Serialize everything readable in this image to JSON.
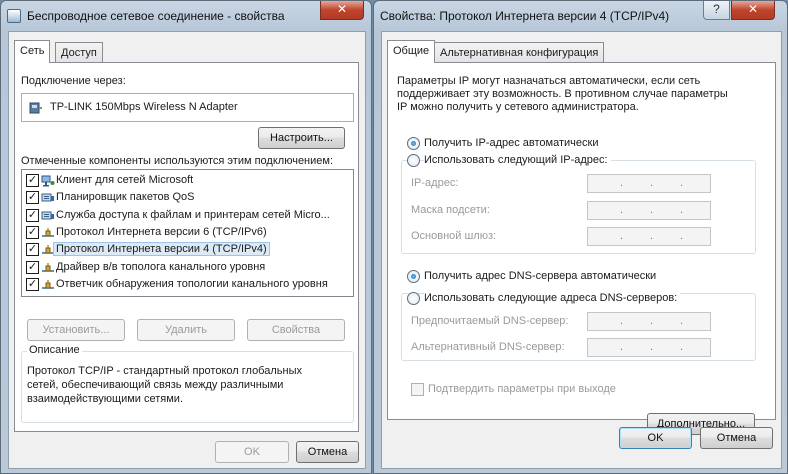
{
  "left_window": {
    "title": "Беспроводное сетевое соединение - свойства",
    "close_label": "✕",
    "tabs": [
      "Сеть",
      "Доступ"
    ],
    "connect_via_label": "Подключение через:",
    "adapter_name": "TP-LINK 150Mbps Wireless N Adapter",
    "configure_label": "Настроить...",
    "components_label": "Отмеченные компоненты используются этим подключением:",
    "components": [
      {
        "label": "Клиент для сетей Microsoft",
        "checked": true,
        "icon": "network-client-icon"
      },
      {
        "label": "Планировщик пакетов QoS",
        "checked": true,
        "icon": "network-service-icon"
      },
      {
        "label": "Служба доступа к файлам и принтерам сетей Micro...",
        "checked": true,
        "icon": "network-service-icon"
      },
      {
        "label": "Протокол Интернета версии 6 (TCP/IPv6)",
        "checked": true,
        "icon": "protocol-icon"
      },
      {
        "label": "Протокол Интернета версии 4 (TCP/IPv4)",
        "checked": true,
        "icon": "protocol-icon"
      },
      {
        "label": "Драйвер в/в тополога канального уровня",
        "checked": true,
        "icon": "protocol-icon"
      },
      {
        "label": "Ответчик обнаружения топологии канального уровня",
        "checked": true,
        "icon": "protocol-icon"
      }
    ],
    "install_label": "Установить...",
    "remove_label": "Удалить",
    "properties_label": "Свойства",
    "description_title": "Описание",
    "description_text": [
      "Протокол TCP/IP - стандартный протокол глобальных",
      "сетей, обеспечивающий связь между различными",
      "взаимодействующими сетями."
    ],
    "ok_label": "OK",
    "cancel_label": "Отмена"
  },
  "right_window": {
    "title": "Свойства: Протокол Интернета версии 4 (TCP/IPv4)",
    "help_label": "?",
    "close_label": "✕",
    "tabs": [
      "Общие",
      "Альтернативная конфигурация"
    ],
    "intro_lines": [
      "Параметры IP могут назначаться автоматически, если сеть",
      "поддерживает эту возможность. В противном случае параметры",
      "IP можно получить у сетевого администратора."
    ],
    "auto_ip_label": "Получить IP-адрес автоматически",
    "manual_ip_label": "Использовать следующий IP-адрес:",
    "ip_address_label": "IP-адрес:",
    "subnet_mask_label": "Маска подсети:",
    "gateway_label": "Основной шлюз:",
    "auto_dns_label": "Получить адрес DNS-сервера автоматически",
    "manual_dns_label": "Использовать следующие адреса DNS-серверов:",
    "preferred_dns_label": "Предпочитаемый DNS-сервер:",
    "alternate_dns_label": "Альтернативный DNS-сервер:",
    "validate_label": "Подтвердить параметры при выходе",
    "advanced_label": "Дополнительно...",
    "ok_label": "OK",
    "cancel_label": "Отмена",
    "ip_selection": "auto",
    "dns_selection": "auto",
    "validate_checked": false
  }
}
